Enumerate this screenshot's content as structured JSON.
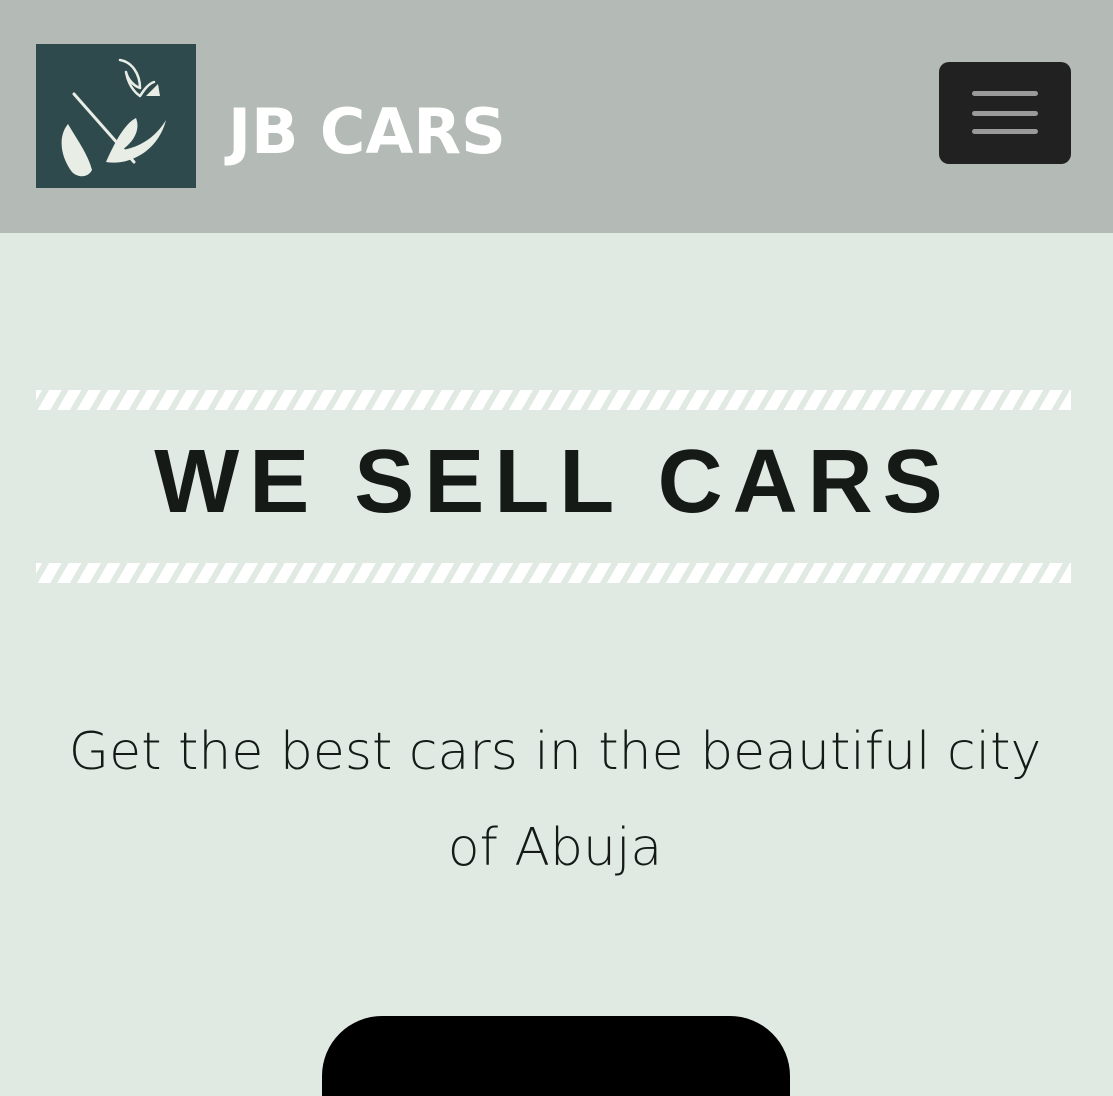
{
  "header": {
    "brand": "JB CARS",
    "logo_icon": "leaf-logo-icon",
    "menu_icon": "hamburger-menu-icon"
  },
  "hero": {
    "title": "WE SELL CARS",
    "subtitle": "Get the best cars in the beautiful city of Abuja",
    "cta_label": ""
  },
  "colors": {
    "header_bg": "#b4bab5",
    "page_bg": "#e0e9e2",
    "logo_bg": "#2f4a4c",
    "menu_bg": "#212121",
    "text_dark": "#151a17"
  }
}
